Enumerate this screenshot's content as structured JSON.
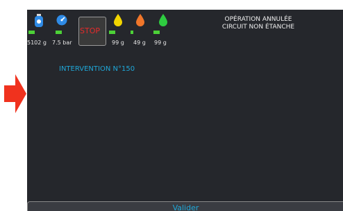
{
  "indicators": {
    "bottle": {
      "value": "5102 g",
      "level": 0.35,
      "color": "#2f8be6"
    },
    "pressure": {
      "value": "7.5 bar",
      "level": 0.35,
      "color": "#2f8be6"
    },
    "stop": {
      "label": "STOP",
      "color": "#e62a2a"
    },
    "oil_yellow": {
      "value": "99 g",
      "level": 0.35,
      "color": "#f2d500"
    },
    "oil_orange": {
      "value": "49 g",
      "level": 0.12,
      "color": "#f0762a"
    },
    "oil_green": {
      "value": "99 g",
      "level": 0.35,
      "color": "#2ecc40"
    }
  },
  "message": {
    "line1": "OPÉRATION ANNULÉE",
    "line2": "CIRCUIT NON ÉTANCHE"
  },
  "intervention": {
    "label": "INTERVENTION N°150"
  },
  "footer": {
    "validate_label": "Valider"
  },
  "arrow": {
    "color": "#f0321e"
  }
}
